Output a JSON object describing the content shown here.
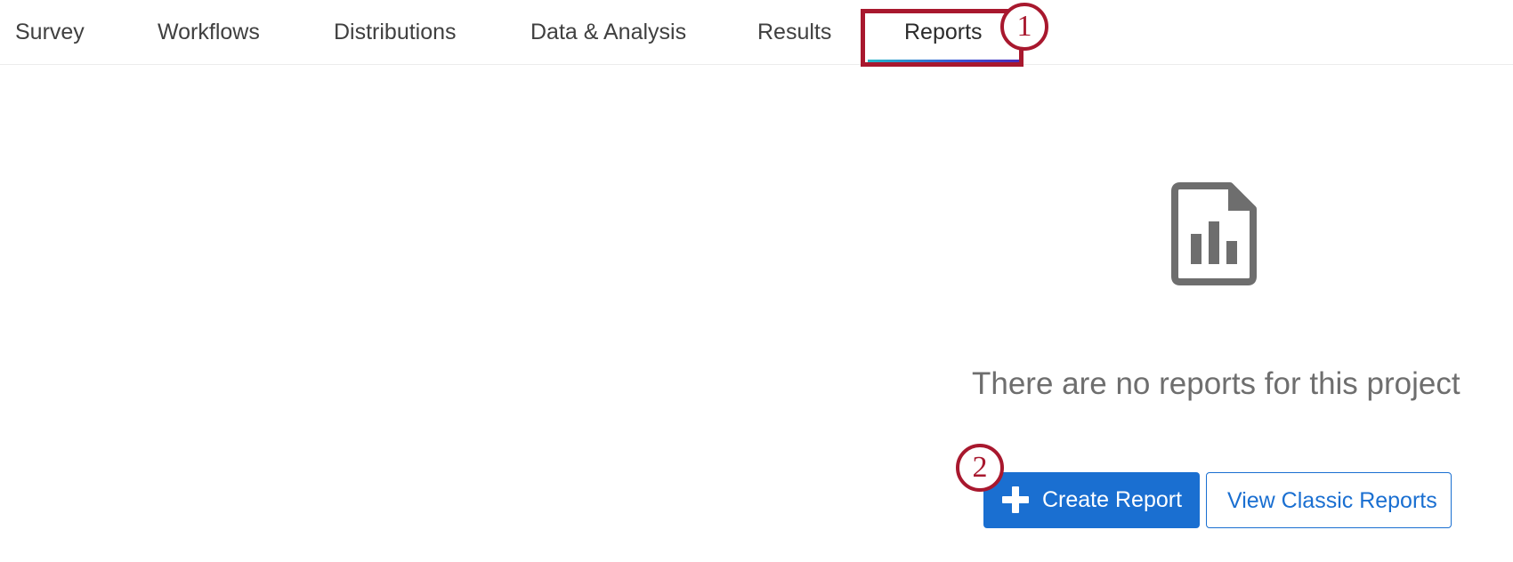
{
  "tabs": [
    {
      "label": "Survey"
    },
    {
      "label": "Workflows"
    },
    {
      "label": "Distributions"
    },
    {
      "label": "Data & Analysis"
    },
    {
      "label": "Results"
    },
    {
      "label": "Reports",
      "active": true
    }
  ],
  "annotations": {
    "step1": "1",
    "step2": "2",
    "color": "#a8182e"
  },
  "empty_state": {
    "icon": "report-document-icon",
    "message": "There are no reports for this project"
  },
  "actions": {
    "create_report": {
      "label": "Create Report",
      "icon": "plus-icon",
      "color": "#1a6fd1"
    },
    "view_classic": {
      "label": "View Classic Reports"
    }
  }
}
